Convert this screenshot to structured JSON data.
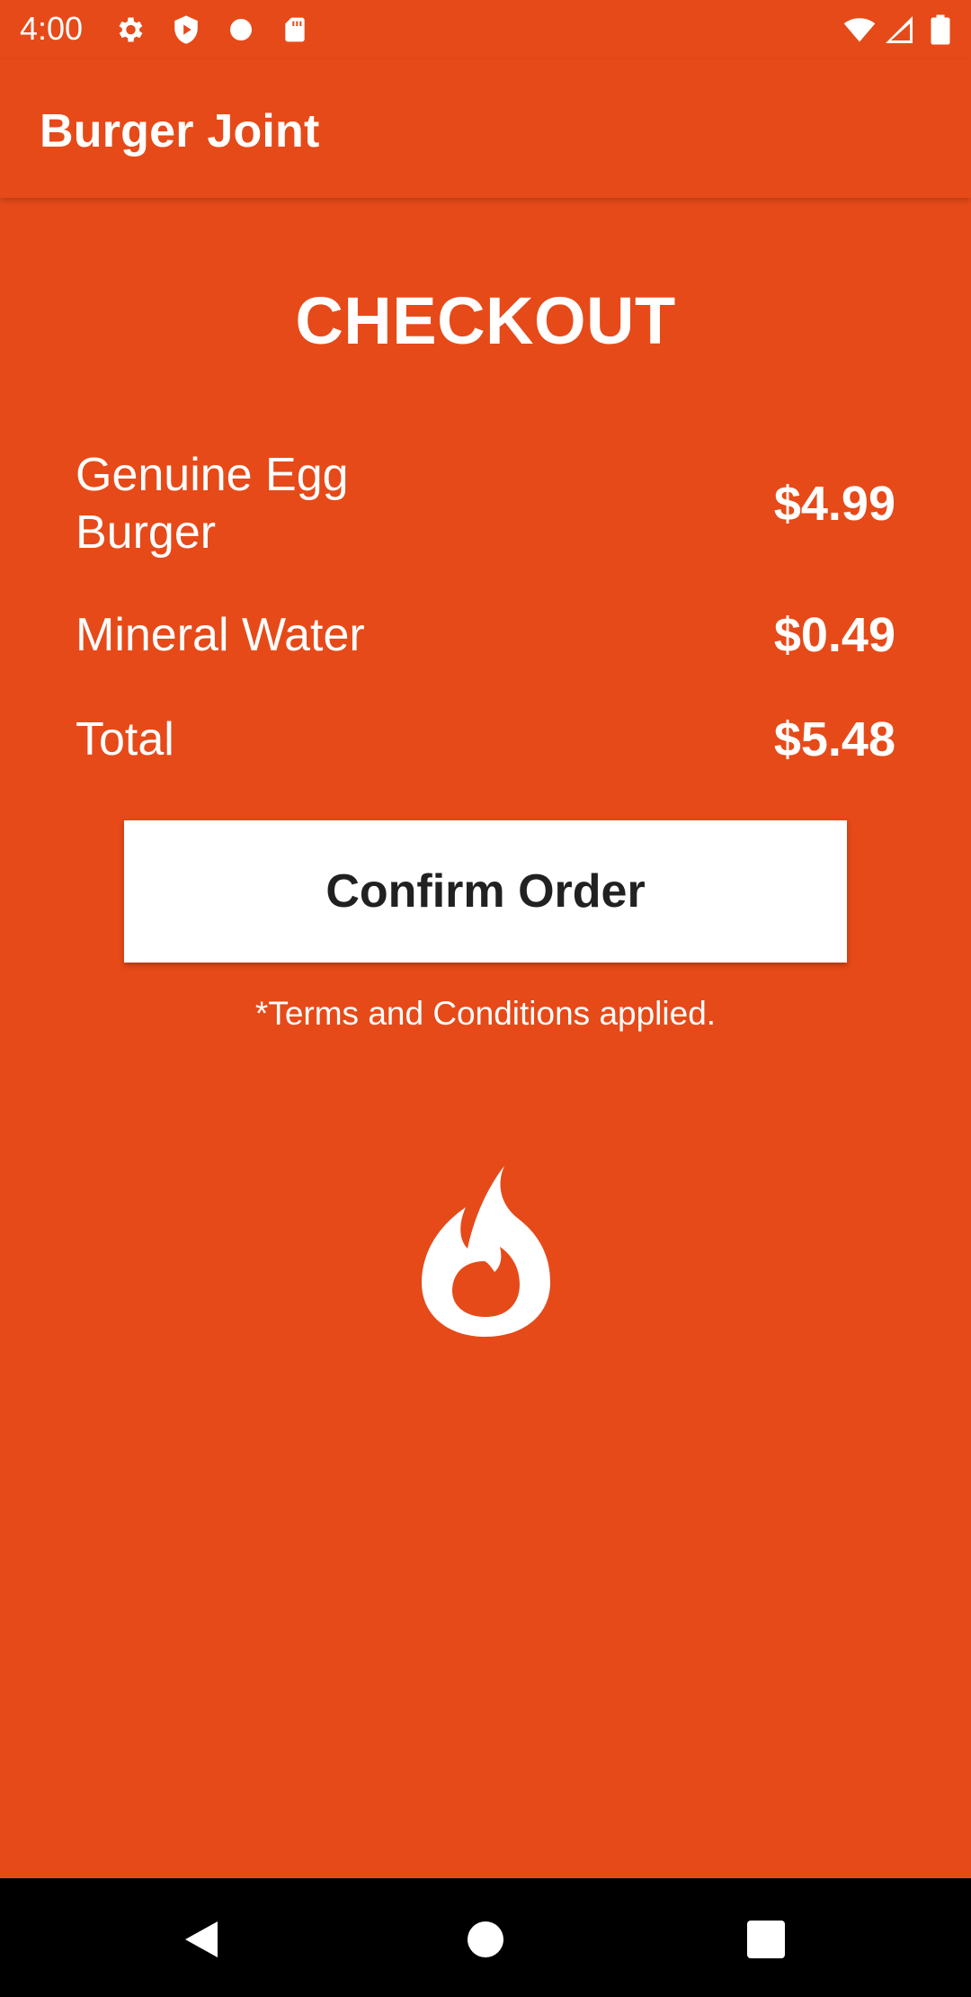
{
  "status_bar": {
    "time": "4:00",
    "left_icons": [
      "gear-icon",
      "shield-play-icon",
      "dot-icon",
      "sd-card-icon"
    ],
    "right_icons": [
      "wifi-icon",
      "signal-icon",
      "battery-icon"
    ]
  },
  "app_bar": {
    "title": "Burger Joint"
  },
  "checkout": {
    "title": "CHECKOUT",
    "items": [
      {
        "name": "Genuine Egg Burger",
        "price": "$4.99"
      },
      {
        "name": "Mineral Water",
        "price": "$0.49"
      }
    ],
    "total": {
      "label": "Total",
      "price": "$5.48"
    },
    "confirm_label": "Confirm Order",
    "terms": "*Terms and Conditions applied."
  },
  "logo": "flame-icon",
  "nav_bar": {
    "buttons": [
      "back-icon",
      "home-icon",
      "recents-icon"
    ]
  },
  "colors": {
    "background": "#E64A19",
    "text": "#FFFFFF",
    "button_bg": "#FFFFFF",
    "button_text": "#212121",
    "nav_bg": "#000000"
  }
}
